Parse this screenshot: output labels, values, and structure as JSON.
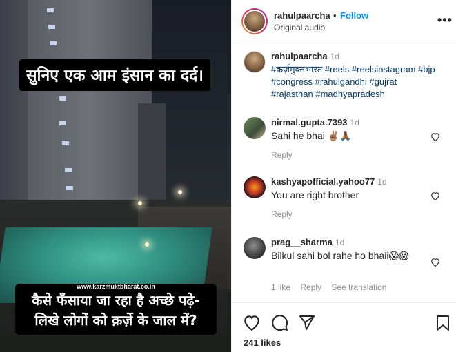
{
  "video": {
    "caption_top": "सुनिए एक आम इंसान का दर्द।",
    "caption_bottom_line1": "कैसे फँसाया जा रहा है अच्छे पढ़े-",
    "caption_bottom_line2": "लिखे लोगों को क़र्ज़े के जाल में?",
    "watermark": "www.karzmuktbharat.co.in"
  },
  "header": {
    "username": "rahulpaarcha",
    "separator": "•",
    "follow_label": "Follow",
    "subtitle": "Original audio",
    "more_label": "•••"
  },
  "caption_comment": {
    "username": "rahulpaarcha",
    "time": "1d",
    "hashtags": [
      "#कर्ज़मुक्तभारत",
      "#reels",
      "#reelsinstagram",
      "#bjp",
      "#congress",
      "#rahulgandhi",
      "#gujrat",
      "#rajasthan",
      "#madhyapradesh"
    ]
  },
  "comments": [
    {
      "username": "nirmal.gupta.7393",
      "time": "1d",
      "text": "Sahi he bhai ✌🏽🙏🏾",
      "reply_label": "Reply"
    },
    {
      "username": "kashyapofficial.yahoo77",
      "time": "1d",
      "text": "You are right brother",
      "reply_label": "Reply"
    },
    {
      "username": "prag__sharma",
      "time": "1d",
      "text": "Bilkul sahi bol rahe ho bhaii😱😱",
      "likes_label": "1 like",
      "reply_label": "Reply",
      "translate_label": "See translation"
    }
  ],
  "footer": {
    "likes": "241 likes",
    "icons": [
      "heart-icon",
      "comment-icon",
      "share-icon",
      "bookmark-icon"
    ]
  },
  "colors": {
    "follow_blue": "#0095f6",
    "hashtag_blue": "#00376b",
    "muted_gray": "#8e8e8e"
  }
}
